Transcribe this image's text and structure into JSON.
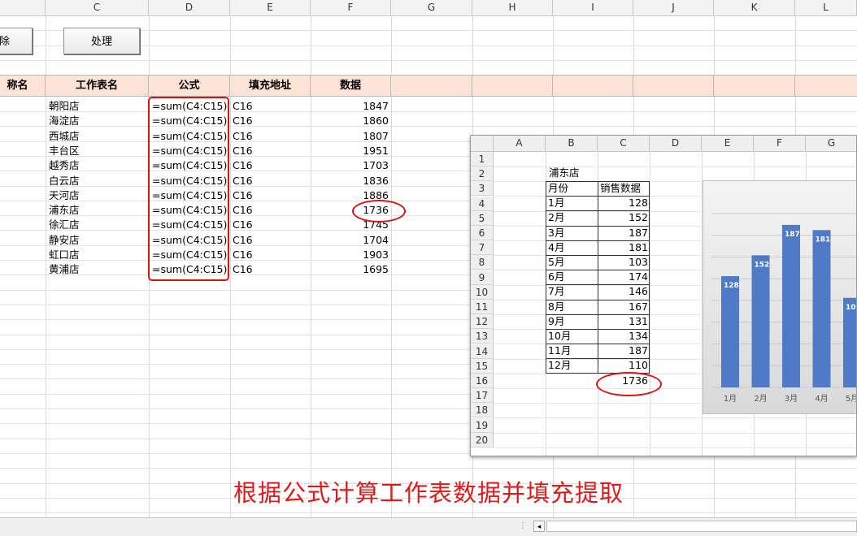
{
  "columns": {
    "main": [
      "C",
      "D",
      "E",
      "F",
      "G",
      "H",
      "I",
      "J",
      "K",
      "L"
    ],
    "embed": [
      "A",
      "B",
      "C",
      "D",
      "E",
      "F",
      "G"
    ]
  },
  "buttons": {
    "left_partial": "除",
    "process": "处理"
  },
  "header": {
    "partial_a": "称名",
    "sheet_name": "工作表名",
    "formula": "公式",
    "fill_address": "填充地址",
    "data": "数据"
  },
  "rows": [
    {
      "sheet": "朝阳店",
      "formula": "=sum(C4:C15)",
      "address": "C16",
      "value": "1847"
    },
    {
      "sheet": "海淀店",
      "formula": "=sum(C4:C15)",
      "address": "C16",
      "value": "1860"
    },
    {
      "sheet": "西城店",
      "formula": "=sum(C4:C15)",
      "address": "C16",
      "value": "1807"
    },
    {
      "sheet": "丰台区",
      "formula": "=sum(C4:C15)",
      "address": "C16",
      "value": "1951"
    },
    {
      "sheet": "越秀店",
      "formula": "=sum(C4:C15)",
      "address": "C16",
      "value": "1703"
    },
    {
      "sheet": "白云店",
      "formula": "=sum(C4:C15)",
      "address": "C16",
      "value": "1836"
    },
    {
      "sheet": "天河店",
      "formula": "=sum(C4:C15)",
      "address": "C16",
      "value": "1886"
    },
    {
      "sheet": "浦东店",
      "formula": "=sum(C4:C15)",
      "address": "C16",
      "value": "1736"
    },
    {
      "sheet": "徐汇店",
      "formula": "=sum(C4:C15)",
      "address": "C16",
      "value": "1745"
    },
    {
      "sheet": "静安店",
      "formula": "=sum(C4:C15)",
      "address": "C16",
      "value": "1704"
    },
    {
      "sheet": "虹口店",
      "formula": "=sum(C4:C15)",
      "address": "C16",
      "value": "1903"
    },
    {
      "sheet": "黄浦店",
      "formula": "=sum(C4:C15)",
      "address": "C16",
      "value": "1695"
    }
  ],
  "embed": {
    "row_numbers": [
      "1",
      "2",
      "3",
      "4",
      "5",
      "6",
      "7",
      "8",
      "9",
      "10",
      "11",
      "12",
      "13",
      "14",
      "15",
      "16",
      "17",
      "18",
      "19",
      "20"
    ],
    "store_title": "浦东店",
    "col_month": "月份",
    "col_sales": "销售数据",
    "months": [
      "1月",
      "2月",
      "3月",
      "4月",
      "5月",
      "6月",
      "7月",
      "8月",
      "9月",
      "10月",
      "11月",
      "12月"
    ],
    "sales": [
      "128",
      "152",
      "187",
      "181",
      "103",
      "174",
      "146",
      "167",
      "131",
      "134",
      "187",
      "110"
    ],
    "total": "1736"
  },
  "chart_data": {
    "type": "bar",
    "categories": [
      "1月",
      "2月",
      "3月",
      "4月",
      "5月"
    ],
    "values": [
      128,
      152,
      187,
      181,
      103
    ],
    "ylim": [
      0,
      200
    ],
    "grid": true,
    "bar_color": "#4f7ac7"
  },
  "caption": "根据公式计算工作表数据并填充提取",
  "colors": {
    "header_fill": "#fde3d6",
    "highlight_red": "#e01010",
    "caption_red": "#e01a1a"
  }
}
